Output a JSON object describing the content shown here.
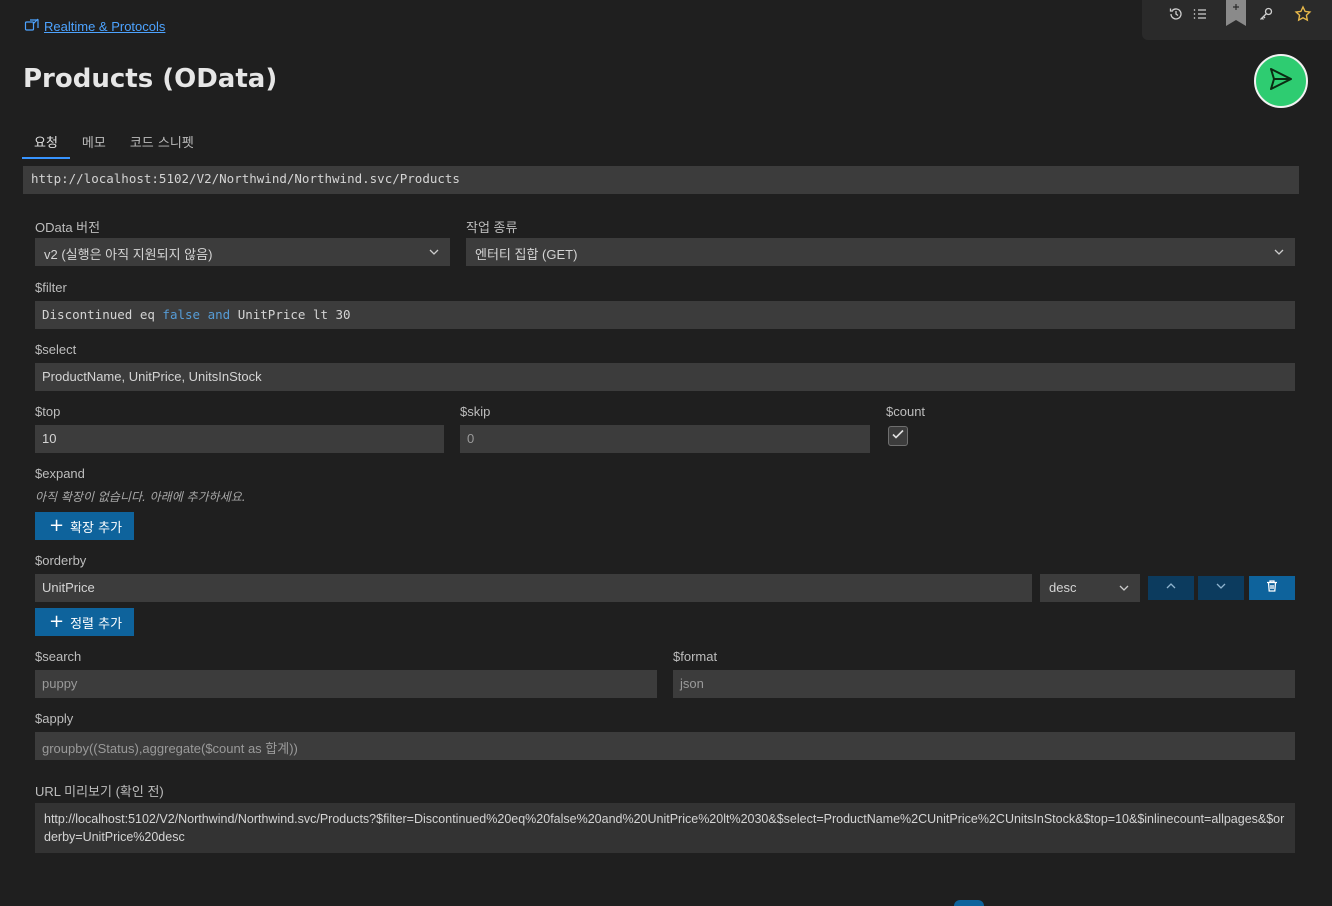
{
  "breadcrumb": {
    "link": "Realtime & Protocols"
  },
  "page": {
    "title": "Products (OData)"
  },
  "tabs": [
    {
      "label": "요청",
      "active": true
    },
    {
      "label": "메모",
      "active": false
    },
    {
      "label": "코드 스니펫",
      "active": false
    }
  ],
  "request": {
    "url": "http://localhost:5102/V2/Northwind/Northwind.svc/Products"
  },
  "odata_version": {
    "label": "OData 버전",
    "value": "v2 (실행은 아직 지원되지 않음)"
  },
  "operation": {
    "label": "작업 종류",
    "value": "엔터티 집합 (GET)"
  },
  "filter": {
    "label": "$filter",
    "tokens": {
      "t1": "Discontinued eq ",
      "t2": "false",
      "t3": " ",
      "t4": "and",
      "t5": " UnitPrice lt 30"
    }
  },
  "select": {
    "label": "$select",
    "value": "ProductName, UnitPrice, UnitsInStock"
  },
  "top": {
    "label": "$top",
    "value": "10"
  },
  "skip": {
    "label": "$skip",
    "value": "0"
  },
  "count": {
    "label": "$count",
    "checked": true
  },
  "expand": {
    "label": "$expand",
    "hint": "아직 확장이 없습니다. 아래에 추가하세요.",
    "add_button": "확장 추가"
  },
  "orderby": {
    "label": "$orderby",
    "field": "UnitPrice",
    "direction": "desc",
    "add_button": "정렬 추가"
  },
  "search": {
    "label": "$search",
    "value": "puppy"
  },
  "format": {
    "label": "$format",
    "value": "json"
  },
  "apply": {
    "label": "$apply",
    "value": "groupby((Status),aggregate($count as 합계))"
  },
  "preview": {
    "label": "URL 미리보기 (확인 전)",
    "value": "http://localhost:5102/V2/Northwind/Northwind.svc/Products?$filter=Discontinued%20eq%20false%20and%20UnitPrice%20lt%2030&$select=ProductName%2CUnitPrice%2CUnitsInStock&$top=10&$inlinecount=allpages&$orderby=UnitPrice%20desc"
  },
  "colors": {
    "accent": "#0e639c",
    "send": "#2ecc71",
    "link": "#4da3ff",
    "keyword": "#569cd6"
  },
  "icons": [
    "history-icon",
    "list-icon",
    "bookmark-icon",
    "key-icon",
    "star-icon",
    "send-icon",
    "chevron-down-icon",
    "chevron-up-icon",
    "trash-icon",
    "check-icon",
    "plus-icon",
    "link-icon"
  ]
}
